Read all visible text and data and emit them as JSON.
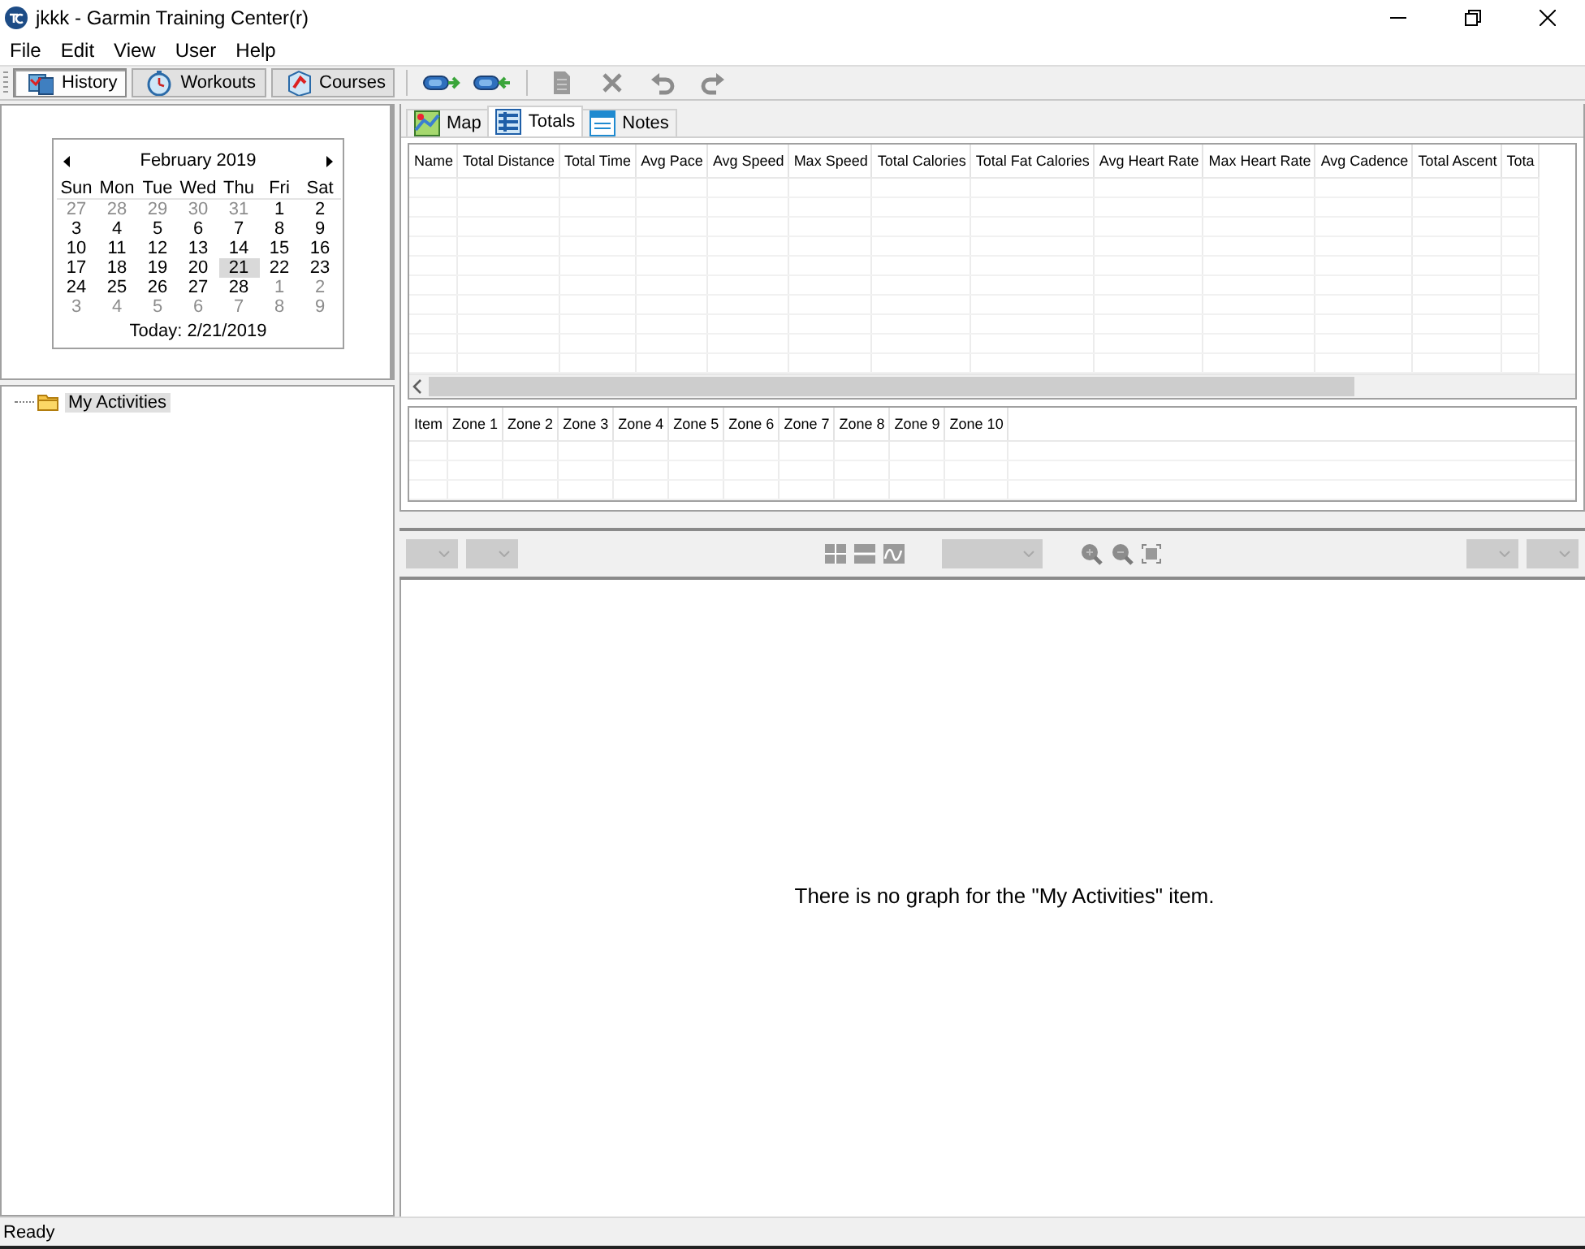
{
  "window": {
    "title": "jkkk - Garmin Training Center(r)"
  },
  "menu": [
    "File",
    "Edit",
    "View",
    "User",
    "Help"
  ],
  "toolbar": {
    "views": [
      {
        "label": "History",
        "selected": true
      },
      {
        "label": "Workouts",
        "selected": false
      },
      {
        "label": "Courses",
        "selected": false
      }
    ]
  },
  "calendar": {
    "month": "February 2019",
    "weekdays": [
      "Sun",
      "Mon",
      "Tue",
      "Wed",
      "Thu",
      "Fri",
      "Sat"
    ],
    "weeks": [
      [
        {
          "day": "27",
          "muted": true,
          "selected": false
        },
        {
          "day": "28",
          "muted": true,
          "selected": false
        },
        {
          "day": "29",
          "muted": true,
          "selected": false
        },
        {
          "day": "30",
          "muted": true,
          "selected": false
        },
        {
          "day": "31",
          "muted": true,
          "selected": false
        },
        {
          "day": "1",
          "muted": false,
          "selected": false
        },
        {
          "day": "2",
          "muted": false,
          "selected": false
        }
      ],
      [
        {
          "day": "3",
          "muted": false,
          "selected": false
        },
        {
          "day": "4",
          "muted": false,
          "selected": false
        },
        {
          "day": "5",
          "muted": false,
          "selected": false
        },
        {
          "day": "6",
          "muted": false,
          "selected": false
        },
        {
          "day": "7",
          "muted": false,
          "selected": false
        },
        {
          "day": "8",
          "muted": false,
          "selected": false
        },
        {
          "day": "9",
          "muted": false,
          "selected": false
        }
      ],
      [
        {
          "day": "10",
          "muted": false,
          "selected": false
        },
        {
          "day": "11",
          "muted": false,
          "selected": false
        },
        {
          "day": "12",
          "muted": false,
          "selected": false
        },
        {
          "day": "13",
          "muted": false,
          "selected": false
        },
        {
          "day": "14",
          "muted": false,
          "selected": false
        },
        {
          "day": "15",
          "muted": false,
          "selected": false
        },
        {
          "day": "16",
          "muted": false,
          "selected": false
        }
      ],
      [
        {
          "day": "17",
          "muted": false,
          "selected": false
        },
        {
          "day": "18",
          "muted": false,
          "selected": false
        },
        {
          "day": "19",
          "muted": false,
          "selected": false
        },
        {
          "day": "20",
          "muted": false,
          "selected": false
        },
        {
          "day": "21",
          "muted": false,
          "selected": true
        },
        {
          "day": "22",
          "muted": false,
          "selected": false
        },
        {
          "day": "23",
          "muted": false,
          "selected": false
        }
      ],
      [
        {
          "day": "24",
          "muted": false,
          "selected": false
        },
        {
          "day": "25",
          "muted": false,
          "selected": false
        },
        {
          "day": "26",
          "muted": false,
          "selected": false
        },
        {
          "day": "27",
          "muted": false,
          "selected": false
        },
        {
          "day": "28",
          "muted": false,
          "selected": false
        },
        {
          "day": "1",
          "muted": true,
          "selected": false
        },
        {
          "day": "2",
          "muted": true,
          "selected": false
        }
      ],
      [
        {
          "day": "3",
          "muted": true,
          "selected": false
        },
        {
          "day": "4",
          "muted": true,
          "selected": false
        },
        {
          "day": "5",
          "muted": true,
          "selected": false
        },
        {
          "day": "6",
          "muted": true,
          "selected": false
        },
        {
          "day": "7",
          "muted": true,
          "selected": false
        },
        {
          "day": "8",
          "muted": true,
          "selected": false
        },
        {
          "day": "9",
          "muted": true,
          "selected": false
        }
      ]
    ],
    "today": "Today: 2/21/2019"
  },
  "tree": {
    "items": [
      {
        "label": "My Activities",
        "selected": true
      }
    ]
  },
  "tabs": [
    {
      "label": "Map",
      "selected": false
    },
    {
      "label": "Totals",
      "selected": true
    },
    {
      "label": "Notes",
      "selected": false
    }
  ],
  "totals_table": {
    "columns": [
      "Name",
      "Total Distance",
      "Total Time",
      "Avg Pace",
      "Avg Speed",
      "Max Speed",
      "Total Calories",
      "Total Fat Calories",
      "Avg Heart Rate",
      "Max Heart Rate",
      "Avg Cadence",
      "Total Ascent",
      "Tota"
    ]
  },
  "zones_table": {
    "columns": [
      "Item",
      "Zone 1",
      "Zone 2",
      "Zone 3",
      "Zone 4",
      "Zone 5",
      "Zone 6",
      "Zone 7",
      "Zone 8",
      "Zone 9",
      "Zone 10"
    ]
  },
  "graph": {
    "message": "There is no graph for the \"My Activities\" item."
  },
  "status_bar": "Ready"
}
